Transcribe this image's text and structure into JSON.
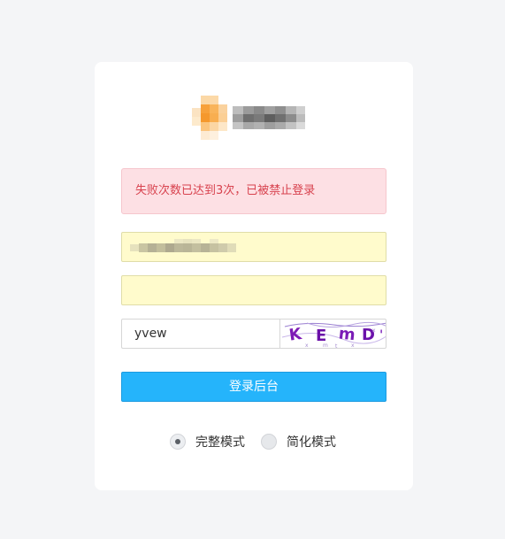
{
  "alert": {
    "message": "失败次数已达到3次，已被禁止登录",
    "color": "#d8424e",
    "background": "#fde0e4"
  },
  "logo": {
    "icon": "pixelated-logo"
  },
  "form": {
    "username": {
      "value": "",
      "placeholder": ""
    },
    "password": {
      "value": "",
      "placeholder": ""
    },
    "captcha": {
      "value": "yvew",
      "image_text": "KEmD"
    },
    "login_label": "登录后台",
    "login_color": "#25b4fb"
  },
  "mode": {
    "options": [
      {
        "label": "完整模式",
        "checked": true
      },
      {
        "label": "简化模式",
        "checked": false
      }
    ]
  }
}
